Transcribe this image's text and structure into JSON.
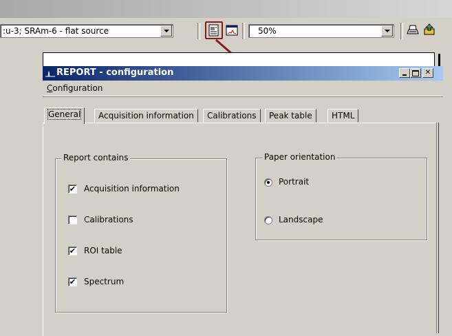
{
  "toolbar": {
    "source_combo_value": ":u-3; SRAm-6 - flat source",
    "zoom_combo_value": "50%"
  },
  "window": {
    "title": "REPORT - configuration",
    "menu": [
      "Configuration"
    ],
    "tabs": [
      {
        "label": "General",
        "active": true
      },
      {
        "label": "Acquisition information",
        "active": false
      },
      {
        "label": "Calibrations",
        "active": false
      },
      {
        "label": "Peak table",
        "active": false
      },
      {
        "label": "HTML",
        "active": false
      }
    ]
  },
  "report_contains": {
    "label": "Report contains",
    "items": [
      {
        "label": "Acquisition information",
        "checked": true
      },
      {
        "label": "Calibrations",
        "checked": false
      },
      {
        "label": "ROI table",
        "checked": true
      },
      {
        "label": "Spectrum",
        "checked": true
      }
    ]
  },
  "paper_orientation": {
    "label": "Paper orientation",
    "options": [
      {
        "label": "Portrait",
        "selected": true
      },
      {
        "label": "Landscape",
        "selected": false
      }
    ]
  },
  "colors": {
    "title_start": "#0a246a",
    "title_end": "#a6caf0",
    "highlight_box": "#8b1a1a",
    "arrow": "#8b1a1a",
    "face": "#d4d0c8"
  },
  "icons": [
    "report-config-icon",
    "spectrum-view-icon",
    "print-icon",
    "export-icon",
    "app-icon"
  ]
}
